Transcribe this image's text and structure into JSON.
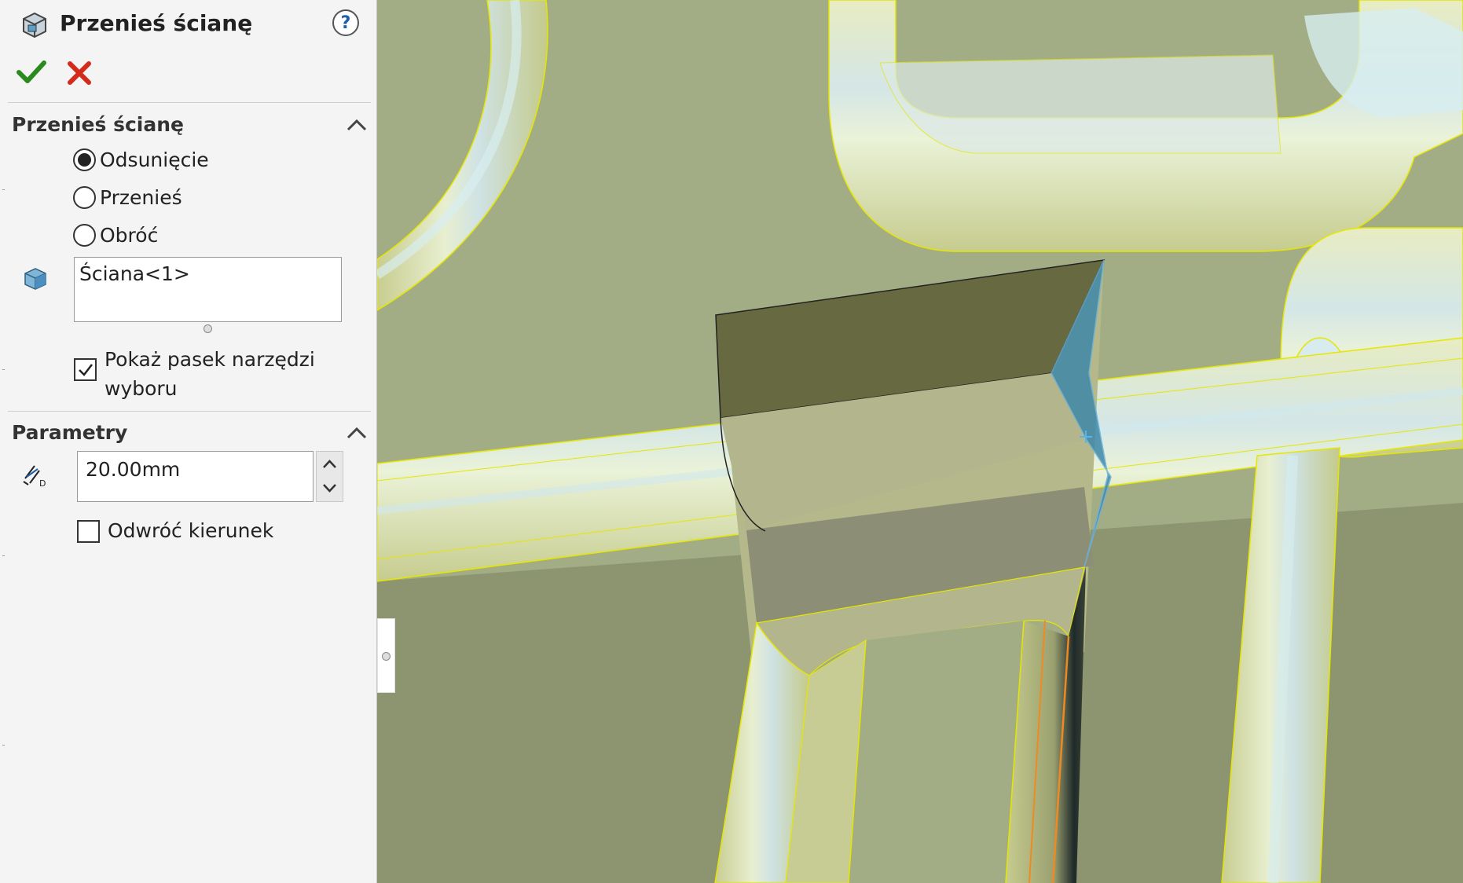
{
  "property_manager": {
    "title": "Przenieś ścianę",
    "help_label": "?",
    "ok_icon": "checkmark-icon",
    "cancel_icon": "close-icon"
  },
  "section_move": {
    "title": "Przenieś ścianę",
    "options": [
      {
        "label": "Odsunięcie",
        "selected": true
      },
      {
        "label": "Przenieś",
        "selected": false
      },
      {
        "label": "Obróć",
        "selected": false
      }
    ],
    "selection_value": "Ściana<1>",
    "show_toolbar_label": "Pokaż pasek narzędzi wyboru",
    "show_toolbar_checked": true
  },
  "section_params": {
    "title": "Parametry",
    "distance_value": "20.00mm",
    "reverse_label": "Odwróć kierunek",
    "reverse_checked": false
  },
  "colors": {
    "viewport_bg": "#a3ad85",
    "edge_highlight": "#f2f200",
    "selected_face": "#3f88a8",
    "accent_ok": "#2b8a1e",
    "accent_cancel": "#d42a1c"
  }
}
